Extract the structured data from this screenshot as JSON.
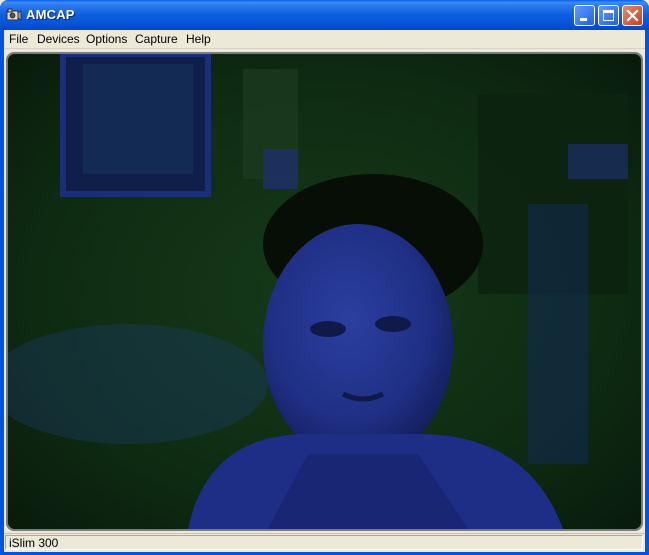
{
  "window": {
    "title": "AMCAP"
  },
  "menu": {
    "items": [
      "File",
      "Devices",
      "Options",
      "Capture",
      "Help"
    ]
  },
  "status": {
    "device": "iSlim 300"
  },
  "colors": {
    "titlebar": "#0653d8",
    "close": "#c5401e",
    "chrome": "#ece9d8"
  },
  "icons": [
    "app-camera-icon",
    "minimize-icon",
    "maximize-icon",
    "close-icon"
  ]
}
